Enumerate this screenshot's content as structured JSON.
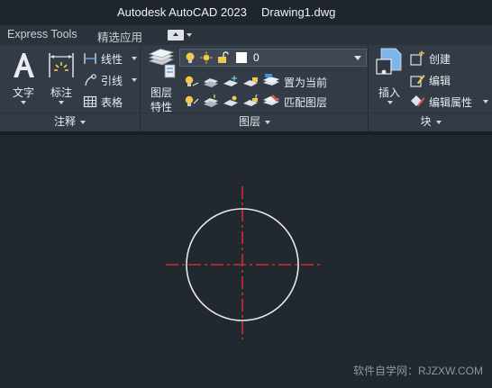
{
  "titlebar": {
    "app": "Autodesk AutoCAD 2023",
    "document": "Drawing1.dwg"
  },
  "tabs": [
    {
      "label": "Express Tools"
    },
    {
      "label": "精选应用"
    }
  ],
  "annotation_panel": {
    "title": "注释",
    "text_label": "文字",
    "dim_label": "标注",
    "linear_label": "线性",
    "leader_label": "引线",
    "table_label": "表格"
  },
  "layer_panel": {
    "title": "图层",
    "props_label_1": "图层",
    "props_label_2": "特性",
    "current_layer": "0",
    "set_current_label": "置为当前",
    "match_layer_label": "匹配图层"
  },
  "block_panel": {
    "title": "块",
    "insert_label": "插入",
    "create_label": "创建",
    "edit_label": "编辑",
    "edit_attr_label": "编辑属性"
  },
  "canvas": {
    "watermark": "软件自学网：RJZXW.COM",
    "circle_color": "#e8e8e8",
    "centerline_color": "#d42a2a"
  },
  "colors": {
    "ribbon_bg": "#323b46",
    "canvas_bg": "#212830",
    "icon_yellow": "#f2c94c"
  }
}
